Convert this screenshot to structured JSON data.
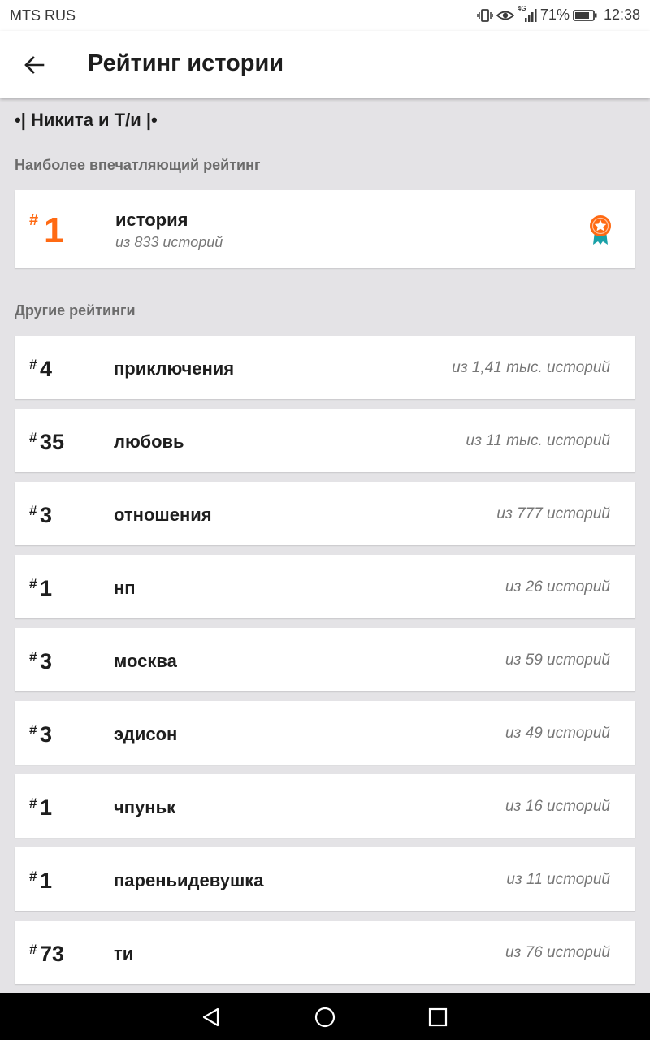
{
  "status_bar": {
    "carrier": "MTS RUS",
    "network_label": "4G",
    "battery": "71%",
    "time": "12:38"
  },
  "app_bar": {
    "title": "Рейтинг истории",
    "back_icon": "arrow-left-icon"
  },
  "story": {
    "title": "•| Никита и Т/и |•"
  },
  "best": {
    "section_label": "Наиболее впечатляющий рейтинг",
    "hash": "#",
    "rank": "1",
    "tag": "история",
    "of_text": "из 833 историй",
    "icon": "award-medal-icon",
    "accent": "#ff6a13",
    "ribbon_color": "#1aa1a8"
  },
  "others": {
    "section_label": "Другие рейтинги",
    "items": [
      {
        "hash": "#",
        "rank": "4",
        "tag": "приключения",
        "of_text": "из 1,41 тыс. историй"
      },
      {
        "hash": "#",
        "rank": "35",
        "tag": "любовь",
        "of_text": "из 11 тыс. историй"
      },
      {
        "hash": "#",
        "rank": "3",
        "tag": "отношения",
        "of_text": "из 777 историй"
      },
      {
        "hash": "#",
        "rank": "1",
        "tag": "нп",
        "of_text": "из 26 историй"
      },
      {
        "hash": "#",
        "rank": "3",
        "tag": "москва",
        "of_text": "из 59 историй"
      },
      {
        "hash": "#",
        "rank": "3",
        "tag": "эдисон",
        "of_text": "из 49 историй"
      },
      {
        "hash": "#",
        "rank": "1",
        "tag": "чпуньк",
        "of_text": "из 16 историй"
      },
      {
        "hash": "#",
        "rank": "1",
        "tag": "пареньидевушка",
        "of_text": "из 11 историй"
      },
      {
        "hash": "#",
        "rank": "73",
        "tag": "ти",
        "of_text": "из 76 историй"
      }
    ]
  },
  "nav_bar": {
    "back_icon": "nav-back-triangle-icon",
    "home_icon": "nav-home-circle-icon",
    "recents_icon": "nav-recents-square-icon"
  }
}
